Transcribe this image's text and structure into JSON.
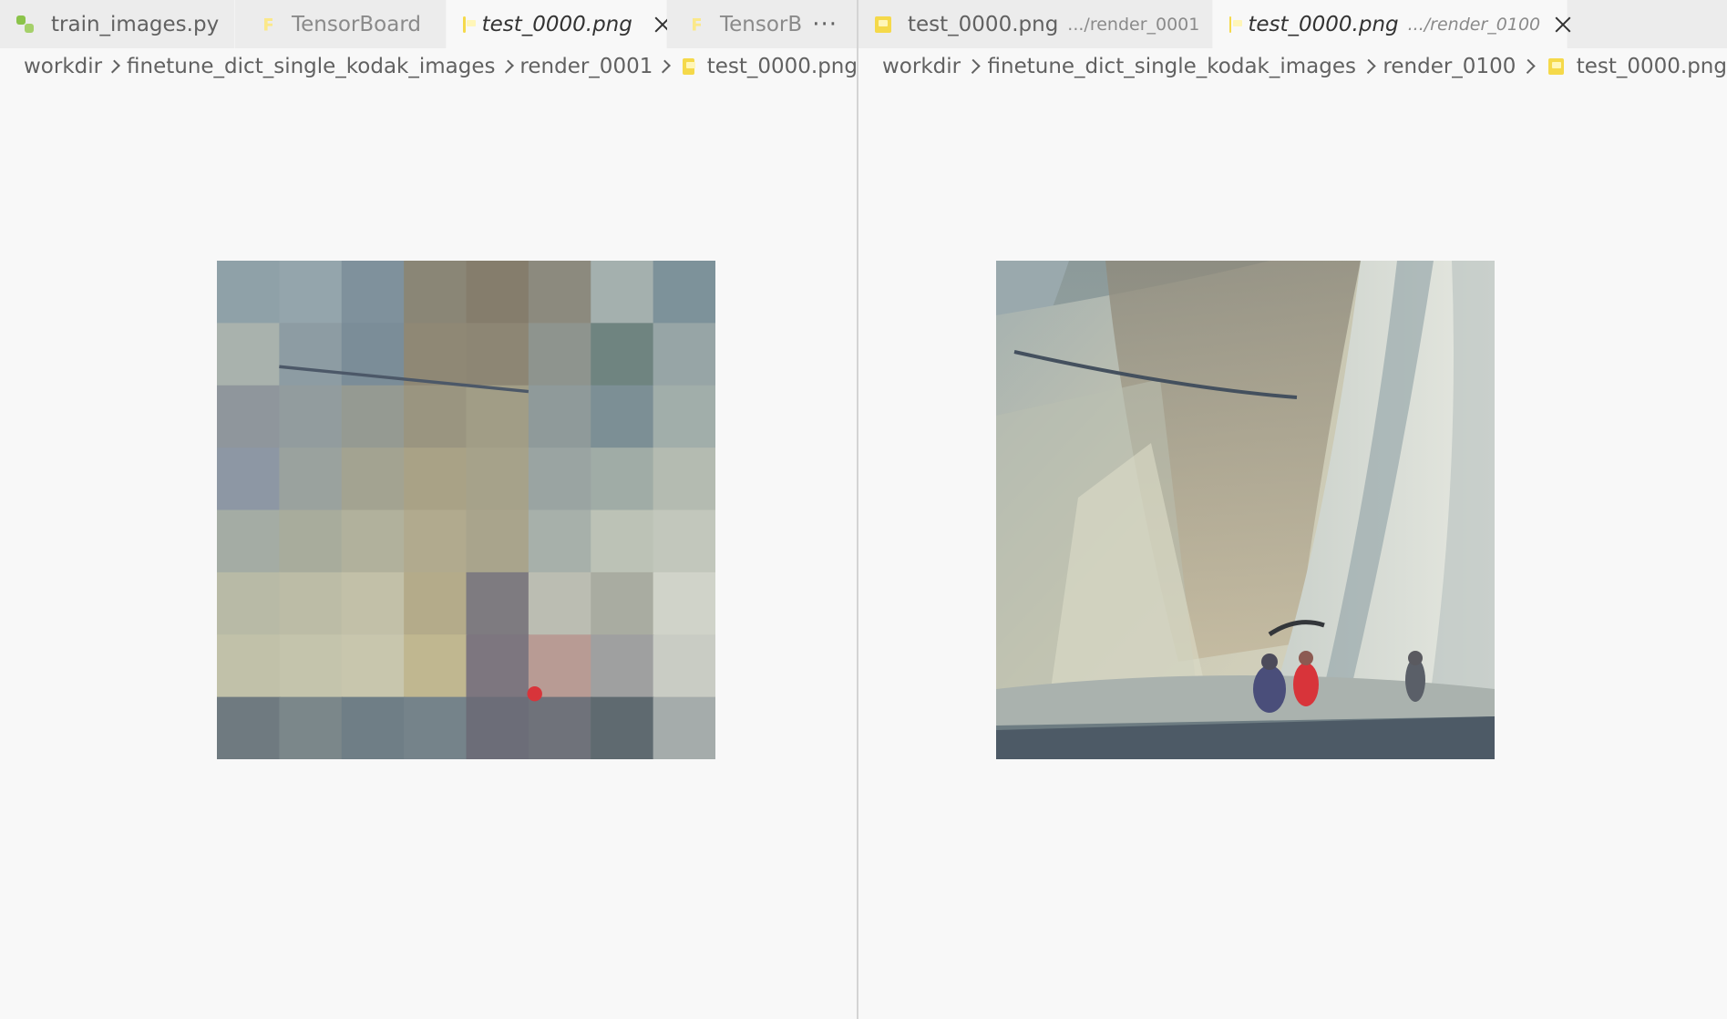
{
  "left_pane": {
    "tabs": [
      {
        "label": "train_images.py",
        "icon": "python-file-icon",
        "state": "inactive"
      },
      {
        "label": "TensorBoard",
        "icon": "tensorboard-icon",
        "state": "inactive"
      },
      {
        "label": "test_0000.png",
        "icon": "image-file-icon",
        "state": "active-preview",
        "close": true
      },
      {
        "label": "TensorBo",
        "icon": "tensorboard-icon",
        "state": "inactive"
      }
    ],
    "more_label": "···",
    "breadcrumb": [
      "workdir",
      "finetune_dict_single_kodak_images",
      "render_0001",
      "test_0000.png"
    ],
    "image_alt": "test_0000.png"
  },
  "right_pane": {
    "tabs": [
      {
        "label": "test_0000.png",
        "description": ".../render_0001",
        "icon": "image-file-icon",
        "state": "inactive"
      },
      {
        "label": "test_0000.png",
        "description": ".../render_0100",
        "icon": "image-file-icon",
        "state": "active-preview",
        "close": true
      }
    ],
    "breadcrumb": [
      "workdir",
      "finetune_dict_single_kodak_images",
      "render_0100",
      "test_0000.png"
    ],
    "image_alt": "test_0000.png"
  },
  "colors": {
    "tabbar_bg": "#ececec",
    "editor_bg": "#f8f8f8",
    "image_file_icon": "#f5d94a",
    "python_icon": "#8bc34a"
  }
}
